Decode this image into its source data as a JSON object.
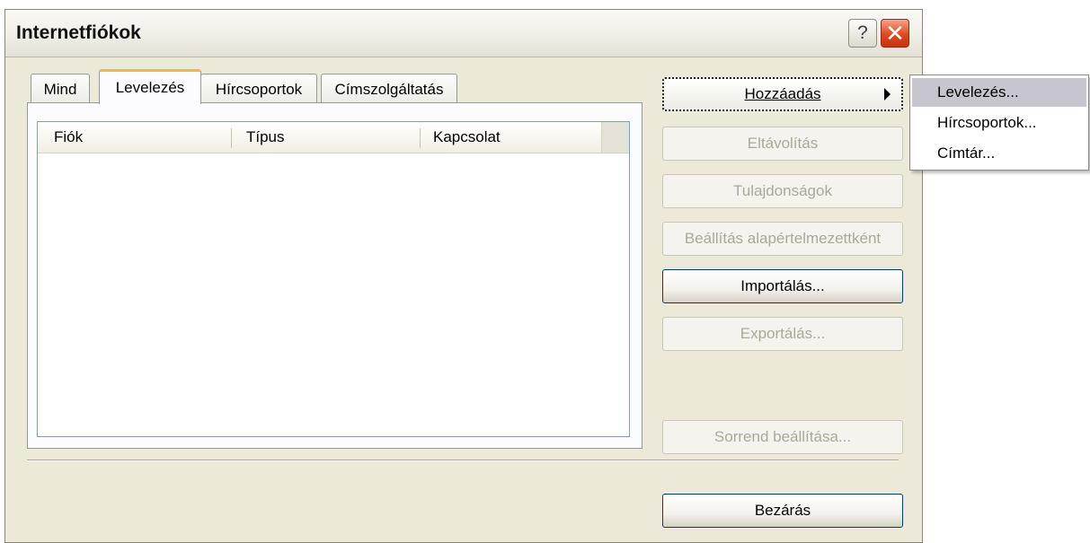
{
  "window": {
    "title": "Internetfiókok"
  },
  "titlebar": {
    "help_glyph": "?",
    "close_glyph": "✕"
  },
  "tabs": [
    {
      "label": "Mind",
      "active": false
    },
    {
      "label": "Levelezés",
      "active": true
    },
    {
      "label": "Hírcsoportok",
      "active": false
    },
    {
      "label": "Címszolgáltatás",
      "active": false
    }
  ],
  "listview": {
    "columns": [
      "Fiók",
      "Típus",
      "Kapcsolat"
    ],
    "rows": []
  },
  "buttons": {
    "add": "Hozzáadás",
    "remove": "Eltávolítás",
    "properties": "Tulajdonságok",
    "set_default": "Beállítás alapértelmezettként",
    "import": "Importálás...",
    "export": "Exportálás...",
    "set_order": "Sorrend beállítása...",
    "close": "Bezárás"
  },
  "add_menu": {
    "items": [
      "Levelezés...",
      "Hírcsoportok...",
      "Címtár..."
    ],
    "selected_index": 0
  },
  "colors": {
    "accent_tab": "#f6b73e",
    "button_border": "#003c74",
    "close_button": "#dd4a22",
    "menu_highlight": "#c7c6cf"
  }
}
